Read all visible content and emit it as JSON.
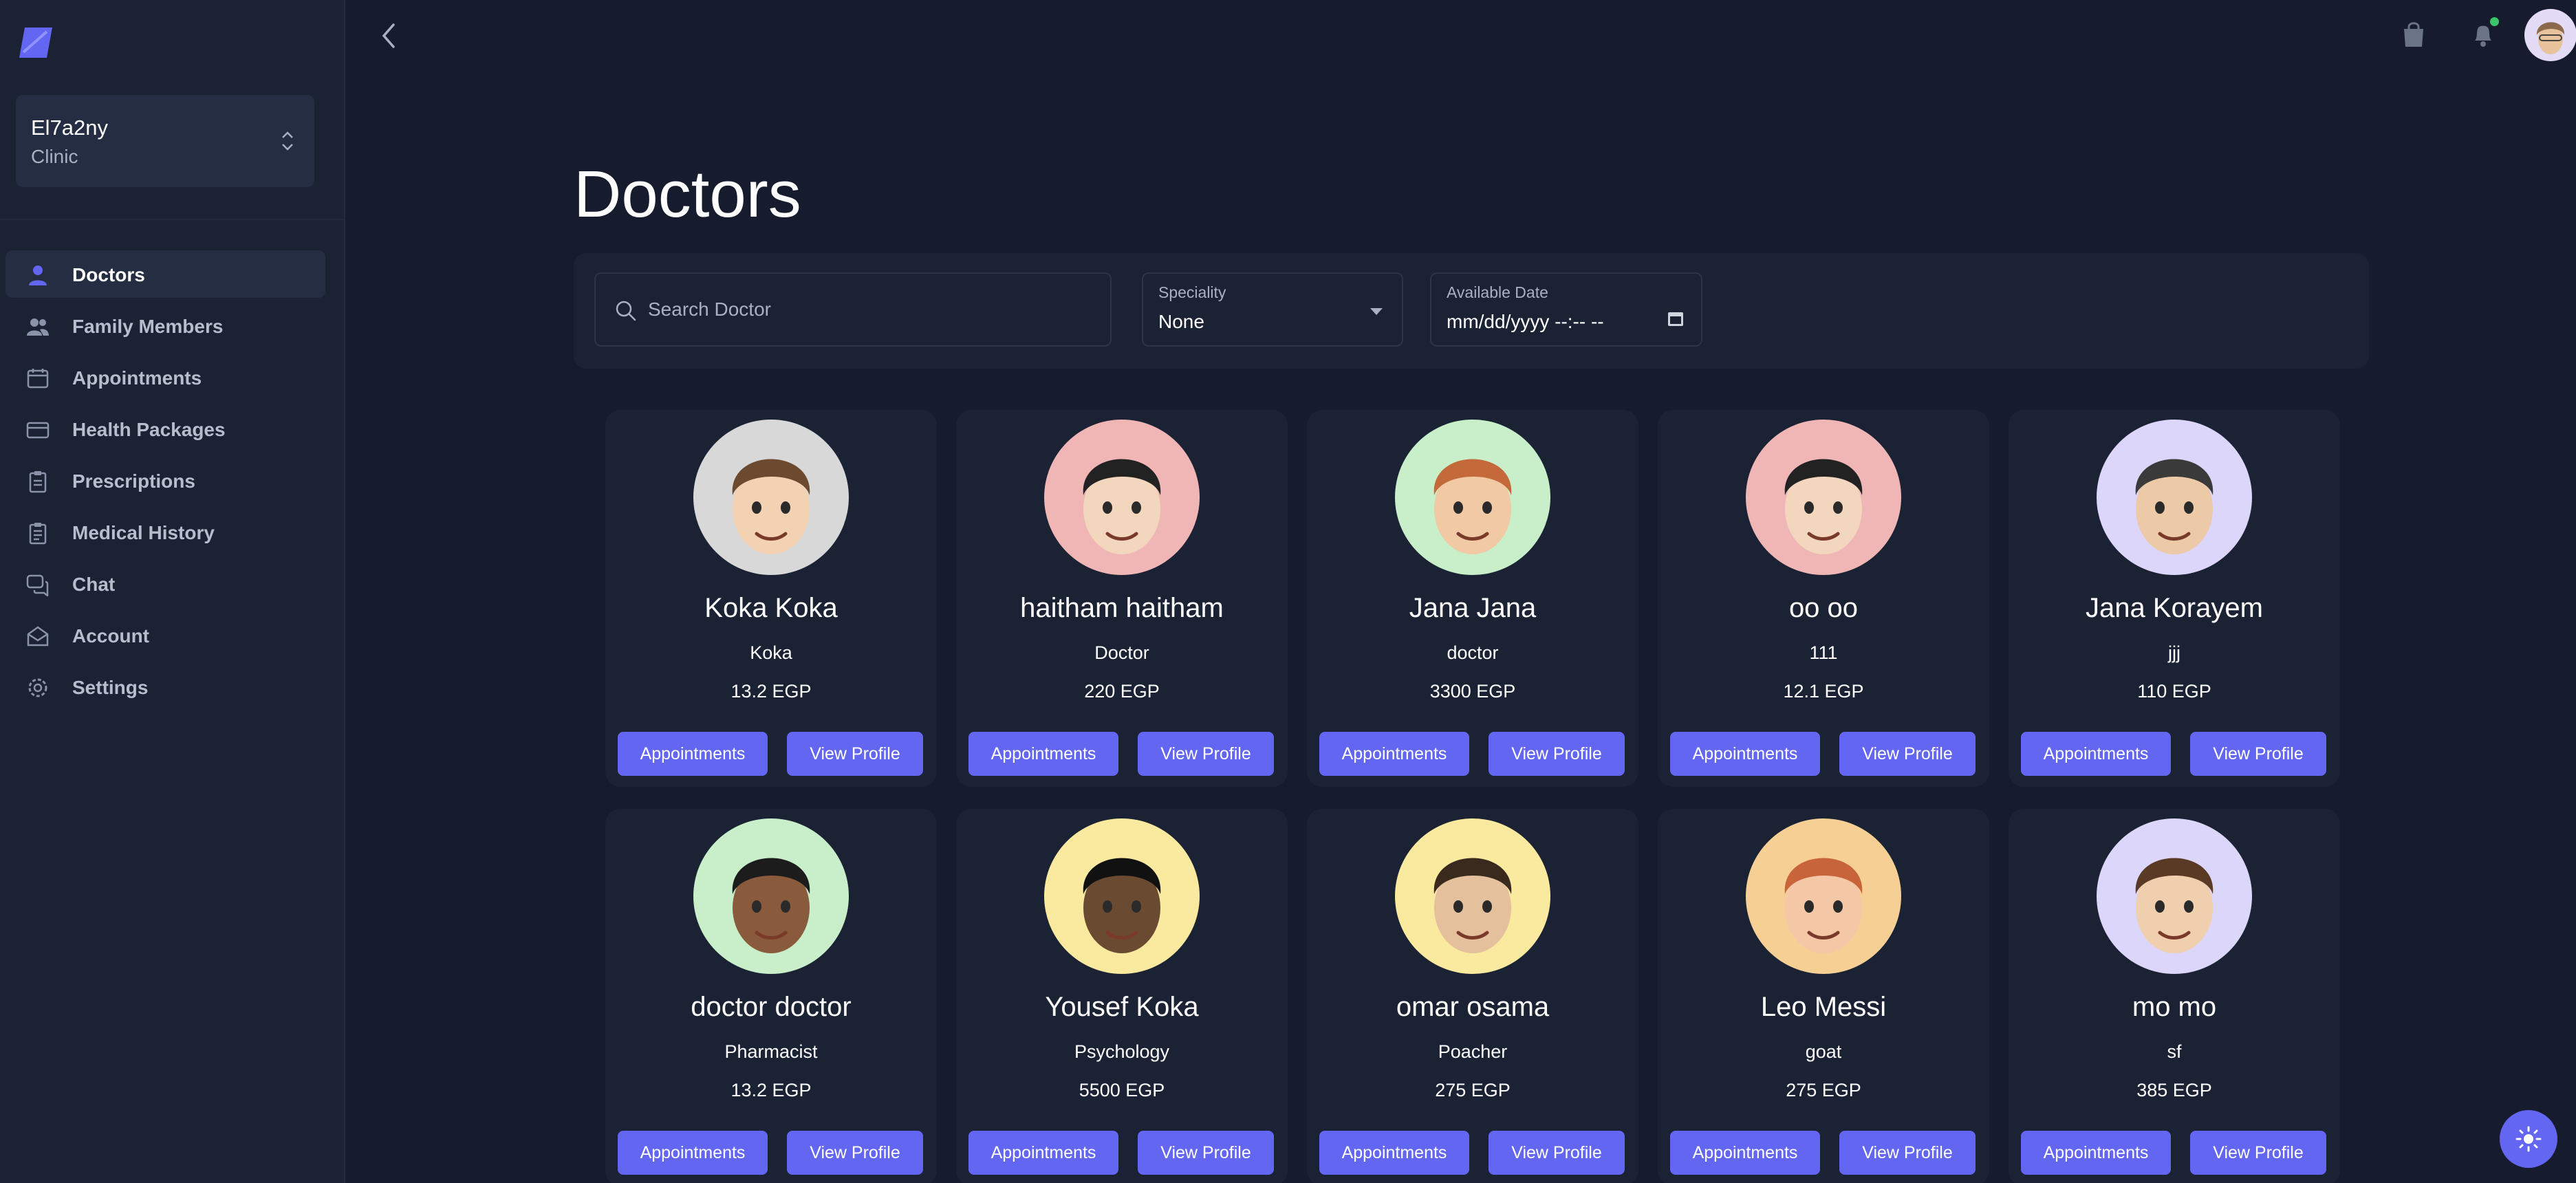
{
  "clinic": {
    "name": "El7a2ny",
    "type": "Clinic"
  },
  "nav": [
    {
      "label": "Doctors",
      "icon": "person-icon",
      "active": true
    },
    {
      "label": "Family Members",
      "icon": "people-icon"
    },
    {
      "label": "Appointments",
      "icon": "calendar-icon"
    },
    {
      "label": "Health Packages",
      "icon": "credit-card-icon"
    },
    {
      "label": "Prescriptions",
      "icon": "clipboard-icon"
    },
    {
      "label": "Medical History",
      "icon": "clipboard-list-icon"
    },
    {
      "label": "Chat",
      "icon": "chat-icon"
    },
    {
      "label": "Account",
      "icon": "mail-open-icon"
    },
    {
      "label": "Settings",
      "icon": "gear-icon"
    }
  ],
  "page": {
    "title": "Doctors"
  },
  "filters": {
    "search_placeholder": "Search Doctor",
    "speciality_label": "Speciality",
    "speciality_value": "None",
    "date_label": "Available Date",
    "date_value": "mm/dd/yyyy --:-- --"
  },
  "buttons": {
    "appointments": "Appointments",
    "view_profile": "View Profile"
  },
  "doctors": [
    {
      "name": "Koka Koka",
      "speciality": "Koka",
      "price": "13.2 EGP",
      "avatar_bg": "#d8d8d8"
    },
    {
      "name": "haitham haitham",
      "speciality": "Doctor",
      "price": "220 EGP",
      "avatar_bg": "#f0b6b6"
    },
    {
      "name": "Jana Jana",
      "speciality": "doctor",
      "price": "3300 EGP",
      "avatar_bg": "#c8efc9"
    },
    {
      "name": "oo oo",
      "speciality": "111",
      "price": "12.1 EGP",
      "avatar_bg": "#f0b6b6"
    },
    {
      "name": "Jana Korayem",
      "speciality": "jjj",
      "price": "110 EGP",
      "avatar_bg": "#ddd6fb"
    },
    {
      "name": "doctor doctor",
      "speciality": "Pharmacist",
      "price": "13.2 EGP",
      "avatar_bg": "#c8efc9"
    },
    {
      "name": "Yousef Koka",
      "speciality": "Psychology",
      "price": "5500 EGP",
      "avatar_bg": "#faeaa0"
    },
    {
      "name": "omar osama",
      "speciality": "Poacher",
      "price": "275 EGP",
      "avatar_bg": "#faeaa0"
    },
    {
      "name": "Leo Messi",
      "speciality": "goat",
      "price": "275 EGP",
      "avatar_bg": "#f6cf94"
    },
    {
      "name": "mo mo",
      "speciality": "sf",
      "price": "385 EGP",
      "avatar_bg": "#ddd6fb"
    }
  ],
  "colors": {
    "accent": "#6366f1",
    "background": "#161b2e",
    "surface": "#1a2234",
    "online": "#3bc46a"
  }
}
